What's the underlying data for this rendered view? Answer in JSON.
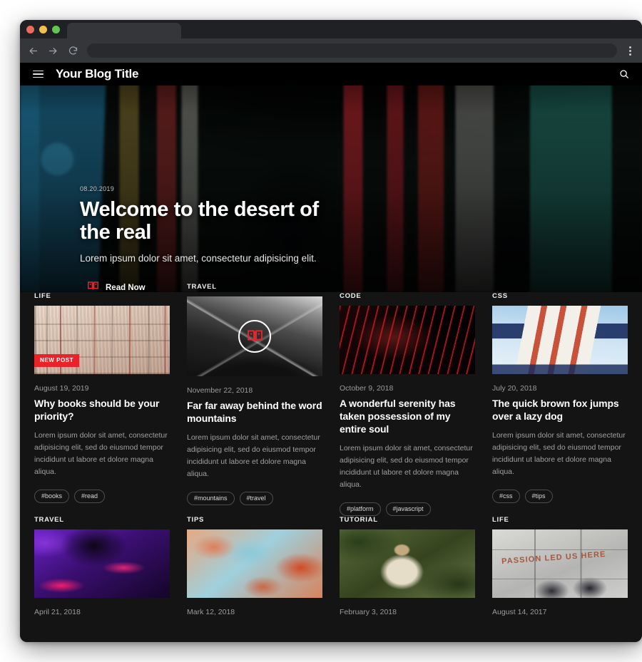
{
  "browser": {
    "tab_title": "",
    "url": "",
    "back_icon": "back-arrow-icon",
    "forward_icon": "forward-arrow-icon",
    "reload_icon": "reload-icon",
    "menu_icon": "kebab-menu-icon"
  },
  "header": {
    "menu_icon": "hamburger-icon",
    "title": "Your Blog Title",
    "search_icon": "search-icon"
  },
  "hero": {
    "date": "08.20.2019",
    "title": "Welcome to the desert of the real",
    "subtitle": "Lorem ipsum dolor sit amet, consectetur adipisicing elit.",
    "cta_label": "Read Now",
    "cta_icon": "open-book-icon"
  },
  "colors": {
    "accent_red": "#e8232a",
    "page_bg": "#141414",
    "header_bg": "#000000",
    "text_primary": "#ffffff",
    "text_muted": "#9b9b9b"
  },
  "rows": [
    {
      "cards": [
        {
          "category": "LIFE",
          "date": "August 19, 2019",
          "title": "Why books should be your priority?",
          "excerpt": "Lorem ipsum dolor sit amet, consectetur adipisicing elit, sed do eiusmod tempor incididunt ut labore et dolore magna aliqua.",
          "tags": [
            "#books",
            "#read"
          ],
          "badge": "NEW POST",
          "featured": false,
          "thumb": "ph-books"
        },
        {
          "category": "TRAVEL",
          "date": "November 22, 2018",
          "title": "Far far away behind the word mountains",
          "excerpt": "Lorem ipsum dolor sit amet, consectetur adipisicing elit, sed do eiusmod tempor incididunt ut labore et dolore magna aliqua.",
          "tags": [
            "#mountains",
            "#travel"
          ],
          "badge": "",
          "featured": true,
          "thumb": "ph-mountains"
        },
        {
          "category": "CODE",
          "date": "October 9, 2018",
          "title": "A wonderful serenity has taken possession of my entire soul",
          "excerpt": "Lorem ipsum dolor sit amet, consectetur adipisicing elit, sed do eiusmod tempor incididunt ut labore et dolore magna aliqua.",
          "tags": [
            "#platform",
            "#javascript"
          ],
          "badge": "",
          "featured": false,
          "thumb": "ph-code"
        },
        {
          "category": "CSS",
          "date": "July 20, 2018",
          "title": "The quick brown fox jumps over a lazy dog",
          "excerpt": "Lorem ipsum dolor sit amet, consectetur adipisicing elit, sed do eiusmod tempor incididunt ut labore et dolore magna aliqua.",
          "tags": [
            "#css",
            "#tips"
          ],
          "badge": "",
          "featured": false,
          "thumb": "ph-building"
        }
      ]
    },
    {
      "cards": [
        {
          "category": "TRAVEL",
          "date": "April 21, 2018",
          "title": "",
          "excerpt": "",
          "tags": [],
          "badge": "",
          "featured": false,
          "thumb": "ph-dj"
        },
        {
          "category": "TIPS",
          "date": "Mark 12, 2018",
          "title": "",
          "excerpt": "",
          "tags": [],
          "badge": "",
          "featured": false,
          "thumb": "ph-clouds"
        },
        {
          "category": "TUTORIAL",
          "date": "February 3, 2018",
          "title": "",
          "excerpt": "",
          "tags": [],
          "badge": "",
          "featured": false,
          "thumb": "ph-dog"
        },
        {
          "category": "LIFE",
          "date": "August 14, 2017",
          "title": "",
          "excerpt": "",
          "tags": [],
          "badge": "",
          "featured": false,
          "thumb": "ph-passion",
          "image_text": "PASSION LED US HERE"
        }
      ]
    }
  ]
}
